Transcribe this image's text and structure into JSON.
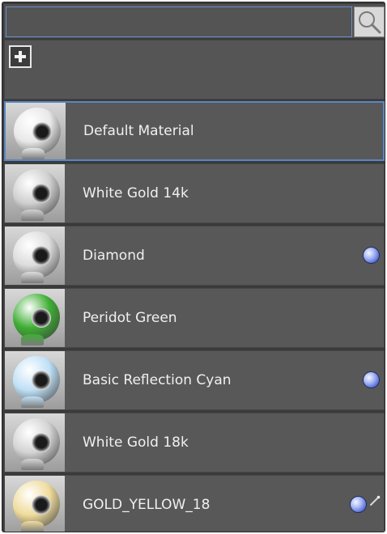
{
  "search": {
    "value": "",
    "placeholder": "",
    "icon": "search-icon"
  },
  "toolbar": {
    "add_icon": "plus-icon"
  },
  "materials": [
    {
      "name": "Default Material",
      "selected": true,
      "indicator": false,
      "edit": false,
      "color": "#e8e8e8"
    },
    {
      "name": "White Gold 14k",
      "selected": false,
      "indicator": false,
      "edit": false,
      "color": "#d0d0d0"
    },
    {
      "name": "Diamond",
      "selected": false,
      "indicator": true,
      "edit": false,
      "color": "#dcdcdc"
    },
    {
      "name": "Peridot Green",
      "selected": false,
      "indicator": false,
      "edit": false,
      "color": "#3fae34"
    },
    {
      "name": "Basic Reflection Cyan",
      "selected": false,
      "indicator": true,
      "edit": false,
      "color": "#bfe0f6"
    },
    {
      "name": "White Gold 18k",
      "selected": false,
      "indicator": false,
      "edit": false,
      "color": "#d4d4d4"
    },
    {
      "name": "GOLD_YELLOW_18",
      "selected": false,
      "indicator": true,
      "edit": true,
      "color": "#f0dc9c"
    }
  ]
}
